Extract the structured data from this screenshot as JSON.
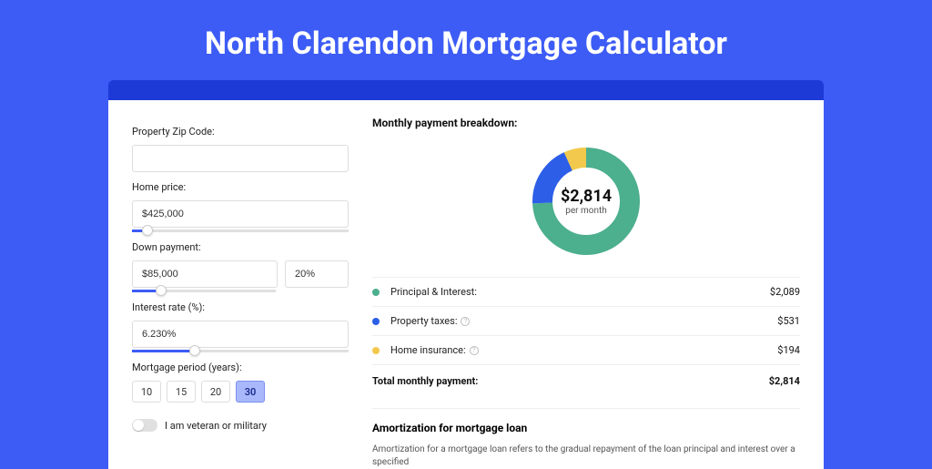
{
  "title": "North Clarendon Mortgage Calculator",
  "form": {
    "zip_label": "Property Zip Code:",
    "zip_value": "",
    "home_price_label": "Home price:",
    "home_price_value": "$425,000",
    "home_price_slider_pct": 7,
    "down_label": "Down payment:",
    "down_value": "$85,000",
    "down_pct": "20%",
    "down_slider_pct": 20,
    "rate_label": "Interest rate (%):",
    "rate_value": "6.230%",
    "rate_slider_pct": 29,
    "period_label": "Mortgage period (years):",
    "periods": [
      "10",
      "15",
      "20",
      "30"
    ],
    "period_active_index": 3,
    "veteran_label": "I am veteran or military",
    "veteran_on": false
  },
  "breakdown": {
    "heading": "Monthly payment breakdown:",
    "center_value": "$2,814",
    "center_sub": "per month",
    "items": [
      {
        "label": "Principal & Interest:",
        "value": "$2,089",
        "color": "#4CAF8E",
        "info": false
      },
      {
        "label": "Property taxes:",
        "value": "$531",
        "color": "#2D5EE8",
        "info": true
      },
      {
        "label": "Home insurance:",
        "value": "$194",
        "color": "#F2C94C",
        "info": true
      }
    ],
    "total_label": "Total monthly payment:",
    "total_value": "$2,814"
  },
  "amort": {
    "heading": "Amortization for mortgage loan",
    "text": "Amortization for a mortgage loan refers to the gradual repayment of the loan principal and interest over a specified"
  },
  "chart_data": {
    "type": "pie",
    "title": "Monthly payment breakdown",
    "series": [
      {
        "name": "Principal & Interest",
        "value": 2089,
        "color": "#4CAF8E"
      },
      {
        "name": "Property taxes",
        "value": 531,
        "color": "#2D5EE8"
      },
      {
        "name": "Home insurance",
        "value": 194,
        "color": "#F2C94C"
      }
    ],
    "total": 2814,
    "center_label": "$2,814 per month"
  }
}
